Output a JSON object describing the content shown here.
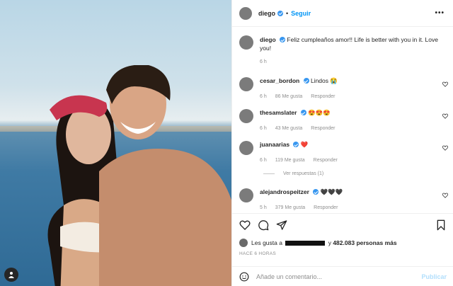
{
  "post": {
    "username": "diego",
    "follow_label": "Seguir",
    "more_label": "•••",
    "caption": "Feliz cumpleaños amor!! Life is better with you in it. Love you!",
    "caption_time": "6 h"
  },
  "comments": [
    {
      "user": "cesar_bordon",
      "verified": true,
      "text": "Lindos 😭",
      "time": "6 h",
      "likes": "86 Me gusta",
      "reply": "Responder"
    },
    {
      "user": "thesamslater",
      "verified": true,
      "text": "😍😍😍",
      "time": "6 h",
      "likes": "43 Me gusta",
      "reply": "Responder"
    },
    {
      "user": "juanaarias",
      "verified": true,
      "text": "❤️",
      "time": "6 h",
      "likes": "119 Me gusta",
      "reply": "Responder"
    },
    {
      "user": "alejandrospeitzer",
      "verified": true,
      "text": "🖤🖤🖤",
      "time": "5 h",
      "likes": "379 Me gusta",
      "reply": "Responder"
    }
  ],
  "view_replies": "Ver respuestas (1)",
  "likes_bar": {
    "prefix": "Les gusta a",
    "suffix_pre": "y",
    "count": "482.083",
    "suffix": "personas más"
  },
  "date_label": "HACE 6 HORAS",
  "comment_input": {
    "placeholder": "Añade un comentario...",
    "publish_label": "Publicar"
  },
  "icons": [
    "heart-icon",
    "comment-icon",
    "share-icon",
    "bookmark-icon",
    "smile-icon"
  ],
  "colors": {
    "accent": "#0095f6",
    "verified": "#3897f0",
    "muted": "#8e8e8e"
  }
}
